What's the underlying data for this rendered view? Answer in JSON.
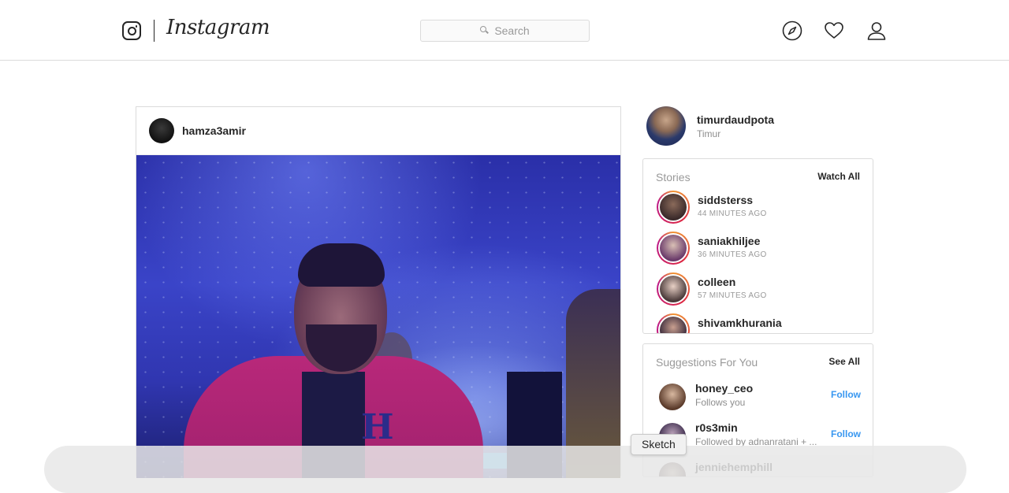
{
  "header": {
    "brand": "Instagram",
    "search_placeholder": "Search"
  },
  "post": {
    "username": "hamza3amir",
    "image_letter": "H"
  },
  "profile": {
    "username": "timurdaudpota",
    "fullname": "Timur"
  },
  "stories": {
    "title": "Stories",
    "action": "Watch All",
    "items": [
      {
        "name": "siddsterss",
        "time": "44 MINUTES AGO"
      },
      {
        "name": "saniakhiljee",
        "time": "36 MINUTES AGO"
      },
      {
        "name": "colleen",
        "time": "57 MINUTES AGO"
      },
      {
        "name": "shivamkhurania",
        "time": ""
      }
    ]
  },
  "suggestions": {
    "title": "Suggestions For You",
    "action": "See All",
    "items": [
      {
        "name": "honey_ceo",
        "subtitle": "Follows you",
        "follow": "Follow"
      },
      {
        "name": "r0s3min",
        "subtitle": "Followed by adnanratani + ...",
        "follow": "Follow"
      },
      {
        "name": "jenniehemphill",
        "subtitle": "",
        "follow": ""
      }
    ]
  },
  "tooltip": "Sketch",
  "colors": {
    "link": "#3897f0",
    "border": "#dbdbdb",
    "text": "#262626",
    "muted": "#8e8e8e"
  }
}
